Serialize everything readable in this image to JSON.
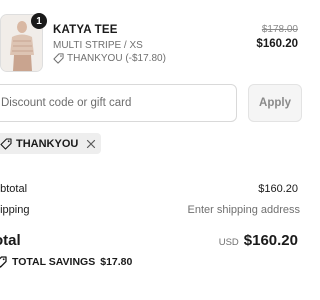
{
  "line_item": {
    "quantity": "1",
    "name": "KATYA TEE",
    "variant": "MULTI STRIPE / XS",
    "discount": "THANKYOU (-$17.80)",
    "compare_price": "$178.00",
    "price": "$160.20"
  },
  "discount_form": {
    "placeholder": "Discount code or gift card",
    "apply_label": "Apply"
  },
  "applied_code": {
    "label": "THANKYOU"
  },
  "summary": {
    "subtotal_label": "ubtotal",
    "subtotal_value": "$160.20",
    "shipping_label": "hipping",
    "shipping_value": "Enter shipping address",
    "total_label": "otal",
    "currency": "USD",
    "total_value": "$160.20",
    "savings_label": "TOTAL SAVINGS",
    "savings_value": "$17.80"
  },
  "icons": {
    "discount": "tag-icon",
    "remove": "close-icon",
    "savings": "tag-icon"
  }
}
